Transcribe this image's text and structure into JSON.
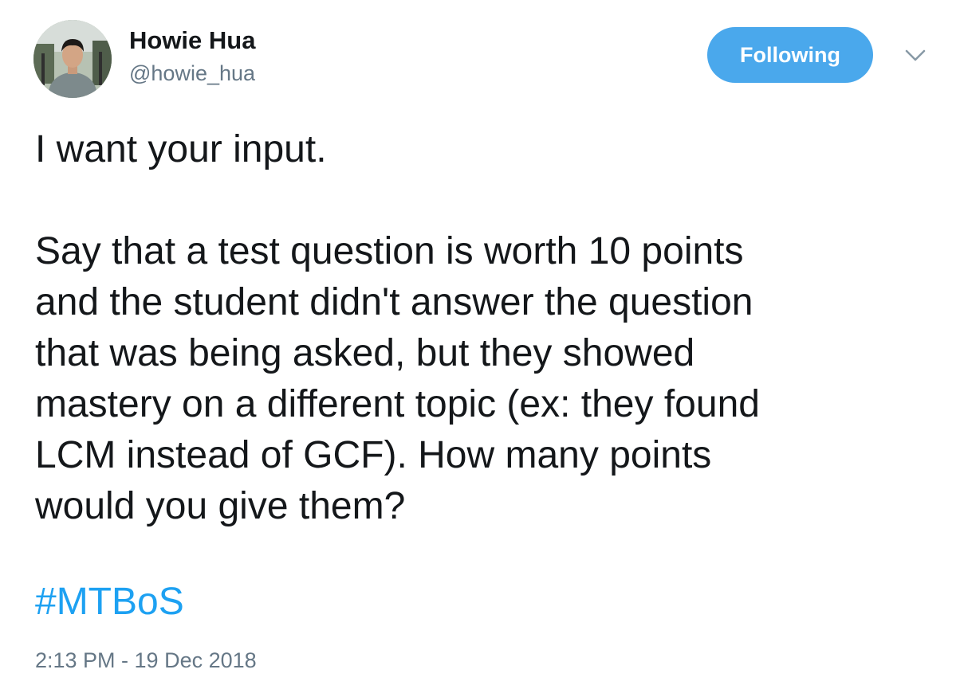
{
  "author": {
    "name": "Howie Hua",
    "handle": "@howie_hua",
    "avatar_icon": "profile-photo"
  },
  "follow_button": {
    "label": "Following",
    "color": "#4aa8ec"
  },
  "menu": {
    "icon": "chevron-down-icon"
  },
  "tweet": {
    "line1": "I want your input.",
    "paragraph_lines": [
      "Say that a test question is worth 10 points",
      "and the student didn't answer the question",
      "that was being asked, but they showed",
      "mastery on a different topic (ex: they found",
      "LCM instead of GCF). How many points",
      "would you give them?"
    ],
    "hashtag": "#MTBoS",
    "timestamp": "2:13 PM - 19 Dec 2018"
  },
  "colors": {
    "text": "#14171a",
    "secondary": "#657786",
    "link": "#1da1f2"
  }
}
